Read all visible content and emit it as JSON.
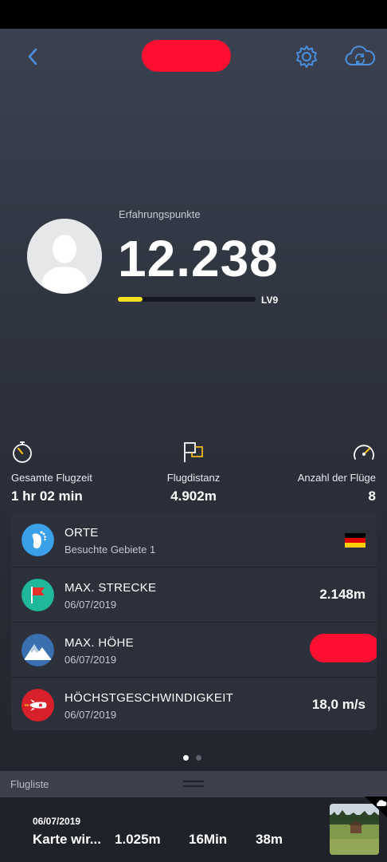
{
  "statusbar": {},
  "nav": {
    "back_icon": "chevron-left-icon",
    "settings_icon": "gear-icon",
    "sync_icon": "cloud-sync-icon",
    "accent_color": "#4a8fe0"
  },
  "profile": {
    "xp_label": "Erfahrungspunkte",
    "xp_value": "12.238",
    "level_label": "LV9",
    "level_progress": 0.18,
    "progress_color": "#f4e01c"
  },
  "stats": [
    {
      "icon": "stopwatch-icon",
      "label": "Gesamte Flugzeit",
      "value": "1 hr 02 min"
    },
    {
      "icon": "flag-icon",
      "label": "Flugdistanz",
      "value": "4.902m"
    },
    {
      "icon": "speedometer-icon",
      "label": "Anzahl der Flüge",
      "value": "8"
    }
  ],
  "records": [
    {
      "icon": "footprint-icon",
      "title": "ORTE",
      "subtitle": "Besuchte Gebiete 1",
      "value": "",
      "color": "#3aa0e8"
    },
    {
      "icon": "flag-icon",
      "title": "MAX. STRECKE",
      "subtitle": "06/07/2019",
      "value": "2.148m",
      "color": "#1fb89a"
    },
    {
      "icon": "mountain-icon",
      "title": "MAX. HÖHE",
      "subtitle": "06/07/2019",
      "value": "",
      "color": "#3a6fb0"
    },
    {
      "icon": "rocket-icon",
      "title": "HÖCHSTGESCHWINDIGKEIT",
      "subtitle": "06/07/2019",
      "value": "18,0 m/s",
      "color": "#d8202a"
    }
  ],
  "pager": {
    "pages": 2,
    "active": 0
  },
  "flight_list": {
    "title": "Flugliste",
    "items": [
      {
        "date": "06/07/2019",
        "name": "Karte wir...",
        "distance": "1.025m",
        "duration": "16Min",
        "altitude": "38m"
      }
    ]
  }
}
